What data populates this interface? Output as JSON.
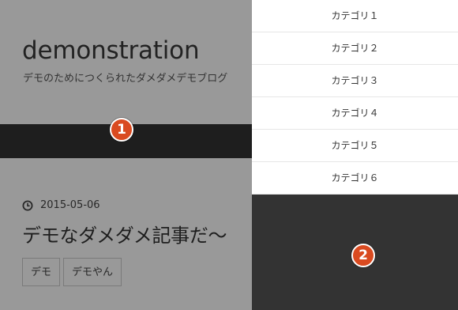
{
  "site": {
    "title": "demonstration",
    "tagline": "デモのためにつくられたダメダメデモブログ"
  },
  "post": {
    "date": "2015-05-06",
    "title": "デモなダメダメ記事だ〜",
    "tags": [
      "デモ",
      "デモやん"
    ]
  },
  "drawer": {
    "items": [
      "カテゴリ１",
      "カテゴリ２",
      "カテゴリ３",
      "カテゴリ４",
      "カテゴリ５",
      "カテゴリ６"
    ]
  },
  "markers": {
    "nav": "1",
    "drawer": "2"
  },
  "colors": {
    "nav_bg": "#333333",
    "drawer_bg": "#333333",
    "marker": "#d94a20"
  }
}
